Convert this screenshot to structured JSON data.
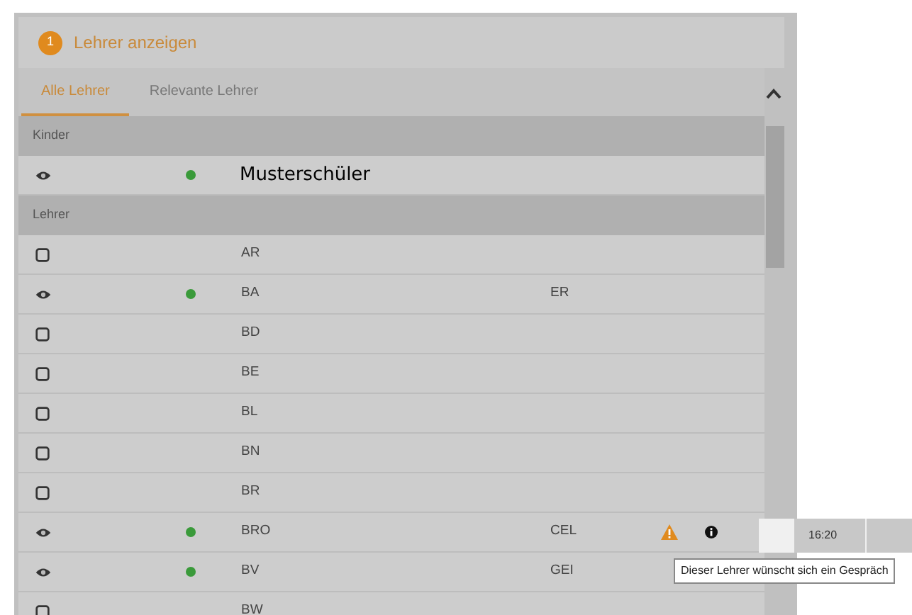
{
  "header": {
    "step": "1",
    "title": "Lehrer anzeigen"
  },
  "tabs": [
    {
      "label": "Alle Lehrer",
      "selected": true
    },
    {
      "label": "Relevante Lehrer",
      "selected": false
    }
  ],
  "sections": [
    {
      "title": "Kinder",
      "rows": [
        {
          "kind": "student",
          "visible": true,
          "online": true,
          "name": "Musterschüler"
        }
      ]
    },
    {
      "title": "Lehrer",
      "rows": [
        {
          "kind": "teacher",
          "visible": false,
          "online": false,
          "name": "AR"
        },
        {
          "kind": "teacher",
          "visible": true,
          "online": true,
          "name": "BA",
          "column_4": "ER"
        },
        {
          "kind": "teacher",
          "visible": false,
          "online": false,
          "name": "BD"
        },
        {
          "kind": "teacher",
          "visible": false,
          "online": false,
          "name": "BE"
        },
        {
          "kind": "teacher",
          "visible": false,
          "online": false,
          "name": "BL"
        },
        {
          "kind": "teacher",
          "visible": false,
          "online": false,
          "name": "BN"
        },
        {
          "kind": "teacher",
          "visible": false,
          "online": false,
          "name": "BR"
        },
        {
          "kind": "teacher",
          "visible": true,
          "online": true,
          "name": "BRO",
          "column_4": "CEL",
          "warning": true,
          "info": true
        },
        {
          "kind": "teacher",
          "visible": true,
          "online": true,
          "name": "BV",
          "column_4": "GEI"
        },
        {
          "kind": "teacher",
          "visible": false,
          "online": false,
          "name": "BW"
        }
      ]
    }
  ],
  "time_cell": "16:20",
  "tooltip": "Dieser Lehrer wünscht sich ein Gespräch"
}
